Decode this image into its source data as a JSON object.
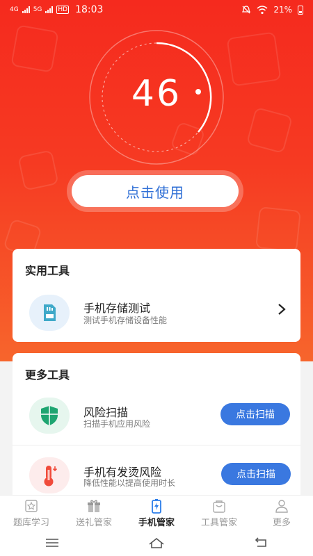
{
  "status_bar": {
    "net1": "4G",
    "net2": "5G",
    "hd": "HD",
    "time": "18:03",
    "battery": "21%"
  },
  "hero": {
    "score": "46",
    "action_label": "点击使用"
  },
  "practical_tools": {
    "title": "实用工具",
    "items": [
      {
        "title": "手机存储测试",
        "desc": "测试手机存储设备性能",
        "icon": "sd-card-icon"
      }
    ]
  },
  "more_tools": {
    "title": "更多工具",
    "items": [
      {
        "title": "风险扫描",
        "desc": "扫描手机应用风险",
        "button": "点击扫描",
        "icon": "shield-icon"
      },
      {
        "title": "手机有发烫风险",
        "desc": "降低性能以提高使用时长",
        "button": "点击扫描",
        "icon": "thermometer-icon"
      }
    ]
  },
  "tabbar": {
    "tabs": [
      {
        "label": "题库学习",
        "icon": "star-box-icon"
      },
      {
        "label": "送礼管家",
        "icon": "gift-icon"
      },
      {
        "label": "手机管家",
        "icon": "battery-bolt-icon"
      },
      {
        "label": "工具管家",
        "icon": "bag-icon"
      },
      {
        "label": "更多",
        "icon": "user-icon"
      }
    ],
    "active_index": 2
  },
  "colors": {
    "hero_top": "#f52a1e",
    "hero_bottom": "#f7652c",
    "accent_blue": "#3a78e0",
    "button_text": "#2f6fd6"
  }
}
